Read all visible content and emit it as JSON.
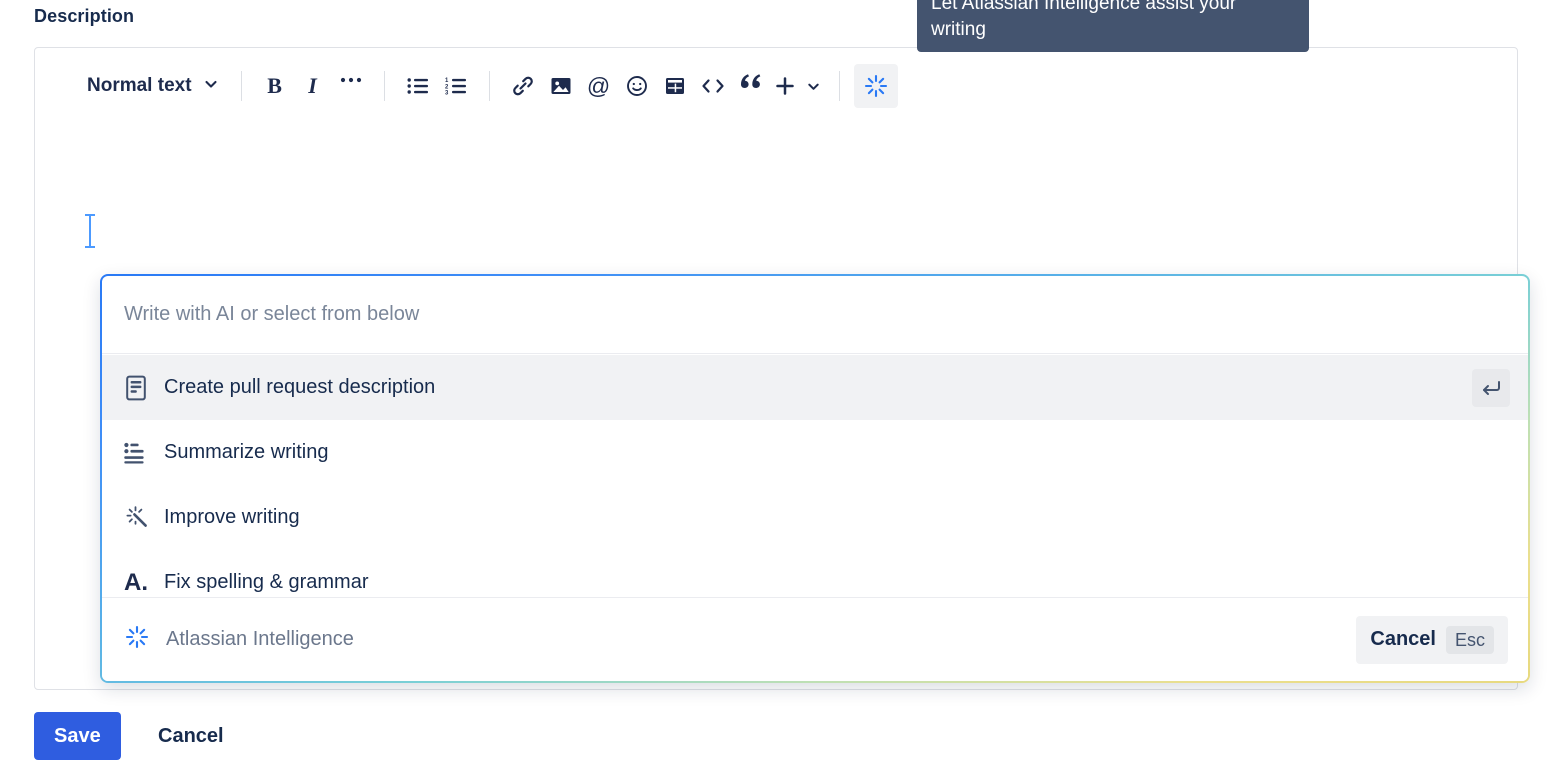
{
  "field": {
    "label": "Description"
  },
  "toolbar": {
    "block_type": "Normal text",
    "buttons": [
      {
        "name": "bold-button",
        "label": "B"
      },
      {
        "name": "italic-button",
        "label": "I"
      },
      {
        "name": "more-formatting-button",
        "label": "•••"
      },
      {
        "name": "bulleted-list-button",
        "label": ""
      },
      {
        "name": "numbered-list-button",
        "label": ""
      },
      {
        "name": "link-button",
        "label": ""
      },
      {
        "name": "image-button",
        "label": ""
      },
      {
        "name": "mention-button",
        "label": "@"
      },
      {
        "name": "emoji-button",
        "label": ""
      },
      {
        "name": "table-button",
        "label": ""
      },
      {
        "name": "code-button",
        "label": "<>"
      },
      {
        "name": "quote-button",
        "label": "”"
      },
      {
        "name": "insert-more-button",
        "label": "+"
      },
      {
        "name": "atlassian-intelligence-button",
        "label": ""
      }
    ],
    "ai_button_active": true
  },
  "tooltip": {
    "text": "Let Atlassian Intelligence assist your writing",
    "background": "#44546f"
  },
  "ai_panel": {
    "input_value": "",
    "input_placeholder": "Write with AI or select from below",
    "options": [
      {
        "icon": "document-icon",
        "label": "Create pull request description",
        "selected": true,
        "shortcut": "enter"
      },
      {
        "icon": "summarize-icon",
        "label": "Summarize writing",
        "selected": false,
        "shortcut": ""
      },
      {
        "icon": "sparkle-wand-icon",
        "label": "Improve writing",
        "selected": false,
        "shortcut": ""
      },
      {
        "icon": "spellcheck-icon",
        "label": "Fix spelling & grammar",
        "selected": false,
        "shortcut": ""
      }
    ],
    "footer": {
      "brand_label": "Atlassian Intelligence",
      "cancel_label": "Cancel",
      "esc_label": "Esc"
    },
    "accent_start": "#2979f5",
    "accent_end": "#e7d97f"
  },
  "actions": {
    "save_label": "Save",
    "cancel_label": "Cancel",
    "primary_color": "#2f5de0"
  }
}
